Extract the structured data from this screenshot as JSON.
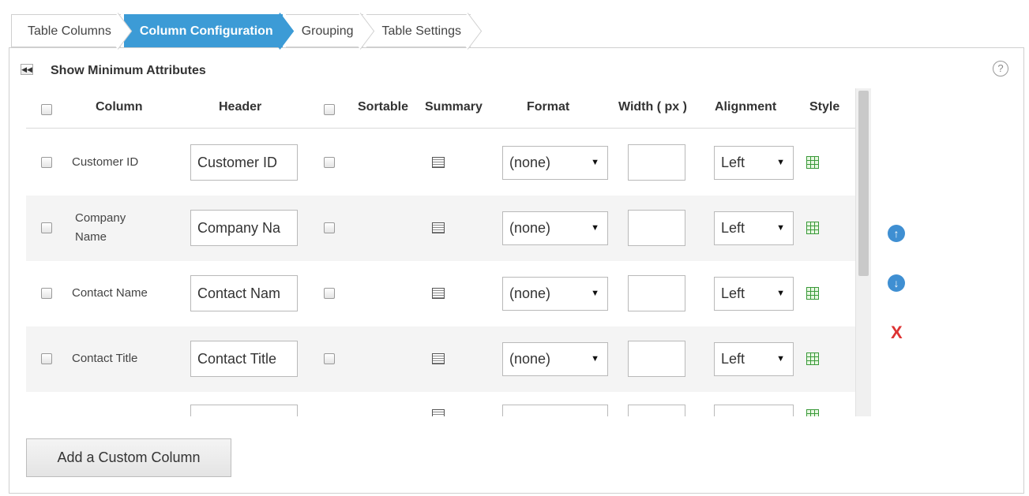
{
  "tabs": [
    {
      "label": "Table Columns"
    },
    {
      "label": "Column Configuration"
    },
    {
      "label": "Grouping"
    },
    {
      "label": "Table Settings"
    }
  ],
  "toolbar": {
    "collapse_glyph": "◀◀",
    "min_attrs_label": "Show Minimum Attributes",
    "help_glyph": "?"
  },
  "table": {
    "headers": {
      "column": "Column",
      "header": "Header",
      "sortable": "Sortable",
      "summary": "Summary",
      "format": "Format",
      "width": "Width ( px )",
      "alignment": "Alignment",
      "style": "Style"
    },
    "rows": [
      {
        "column": "Customer ID",
        "header": "Customer ID",
        "format": "(none)",
        "width": "",
        "alignment": "Left"
      },
      {
        "column": "Company Name",
        "header": "Company Na",
        "format": "(none)",
        "width": "",
        "alignment": "Left"
      },
      {
        "column": "Contact Name",
        "header": "Contact Nam",
        "format": "(none)",
        "width": "",
        "alignment": "Left"
      },
      {
        "column": "Contact Title",
        "header": "Contact Title",
        "format": "(none)",
        "width": "",
        "alignment": "Left"
      }
    ],
    "select_arrow": "▼"
  },
  "side_actions": {
    "move_up_glyph": "↑",
    "move_down_glyph": "↓",
    "remove_glyph": "X"
  },
  "footer": {
    "add_custom_label": "Add a Custom Column"
  },
  "colors": {
    "active_tab": "#3c9bd6",
    "action_blue": "#3f8fd2",
    "remove_red": "#dd3333",
    "style_green": "#3a9a3a"
  },
  "icons": {
    "collapse": "double-left-arrow-icon",
    "help": "question-circle-icon",
    "summary": "list-icon",
    "style": "grid-table-icon",
    "move_up": "arrow-up-circle-icon",
    "move_down": "arrow-down-circle-icon",
    "remove": "x-icon"
  }
}
